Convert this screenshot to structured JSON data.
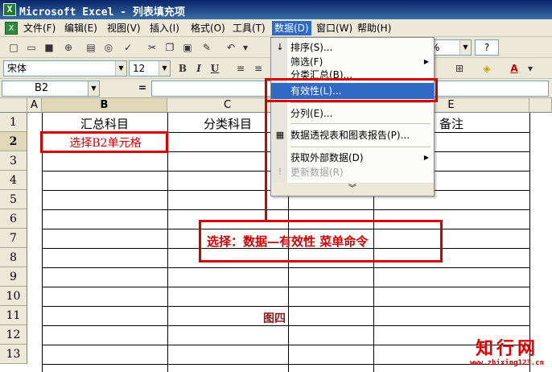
{
  "window": {
    "title": "Microsoft Excel - 列表填充项"
  },
  "menubar": {
    "items": [
      "文件(F)",
      "编辑(E)",
      "视图(V)",
      "插入(I)",
      "格式(O)",
      "工具(T)",
      "数据(D)",
      "窗口(W)",
      "帮助(H)"
    ],
    "active": "数据(D)"
  },
  "toolbar": {
    "font_name": "宋体",
    "font_size": "12",
    "zoom_suffix": "%",
    "help": "?"
  },
  "formula_bar": {
    "name_box": "B2",
    "fx": "="
  },
  "grid": {
    "columns": [
      "A",
      "B",
      "C",
      "E"
    ],
    "rows": [
      "1",
      "2",
      "3",
      "4",
      "5",
      "6",
      "7",
      "8",
      "9",
      "10",
      "11",
      "12",
      "13"
    ],
    "cells": {
      "B1": "汇总科目",
      "C1": "分类科目",
      "E1": "备注",
      "C11": "图四"
    }
  },
  "data_menu": {
    "items": {
      "sort": "排序(S)...",
      "filter": "筛选(F)",
      "subtotal": "分类汇总(B)...",
      "validation": "有效性(L)...",
      "text_to_columns": "分列(E)...",
      "pivot": "数据透视表和图表报告(P)...",
      "external": "获取外部数据(D)",
      "refresh": "更新数据(R)"
    },
    "highlighted": "有效性(L)..."
  },
  "annotations": {
    "cell_note": "选择B2单元格",
    "menu_note": "选择：数据—有效性    菜单命令",
    "accent_color": "#d40000"
  },
  "watermark": {
    "name": "知行网",
    "url": "www.zhixing123.cn"
  }
}
